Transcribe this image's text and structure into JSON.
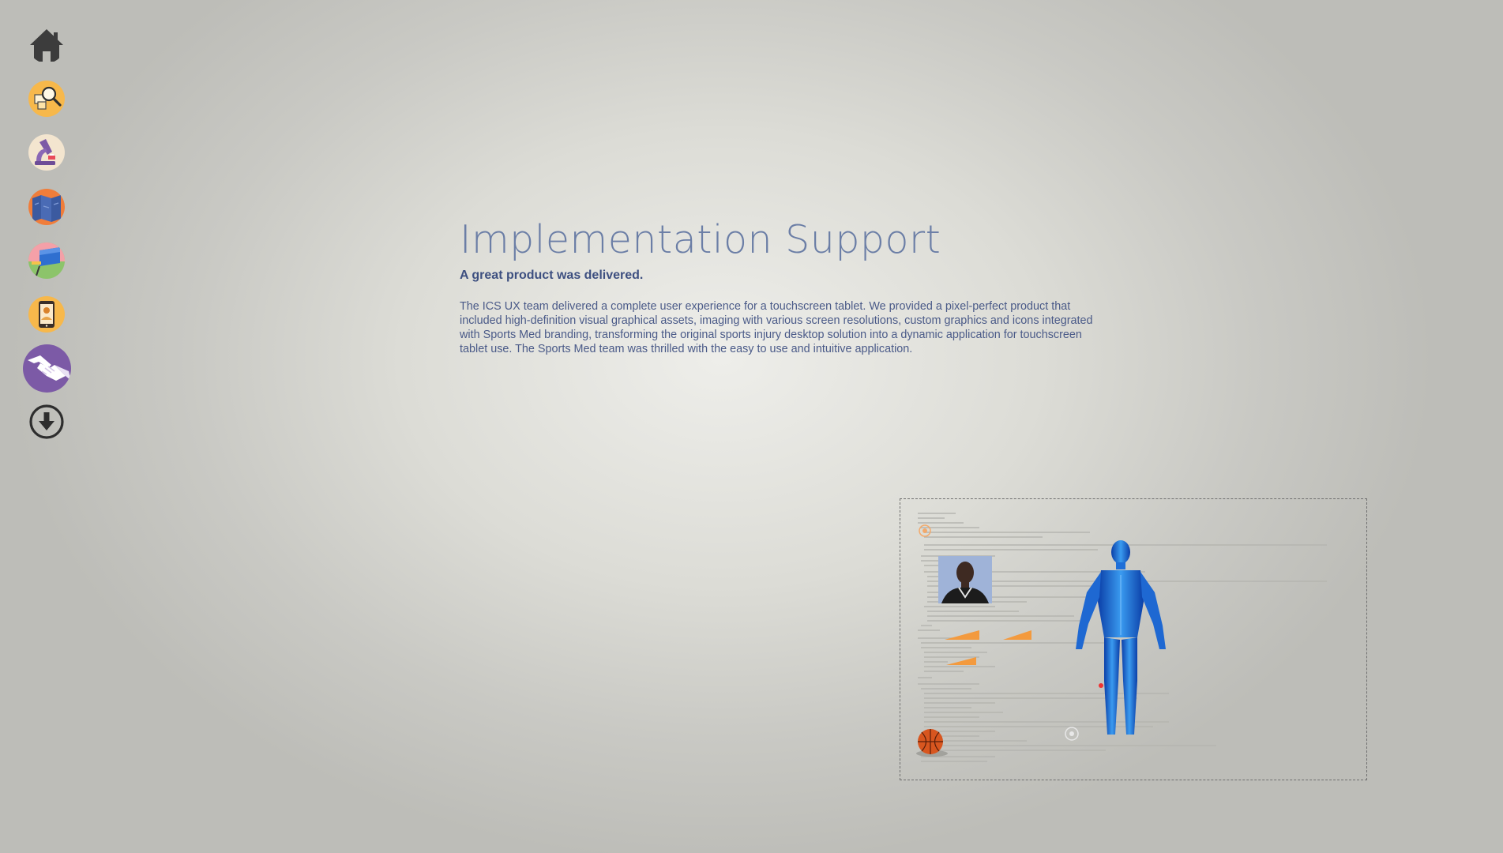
{
  "sidebar": {
    "items": [
      {
        "id": "home",
        "icon": "home-icon",
        "active": false
      },
      {
        "id": "research",
        "icon": "magnifier-analysis-icon",
        "active": false
      },
      {
        "id": "microscope",
        "icon": "microscope-icon",
        "active": false
      },
      {
        "id": "map",
        "icon": "folded-map-icon",
        "active": false
      },
      {
        "id": "design",
        "icon": "easel-design-icon",
        "active": false
      },
      {
        "id": "mobile",
        "icon": "tablet-user-icon",
        "active": false
      },
      {
        "id": "implementation",
        "icon": "handshake-icon",
        "active": true
      },
      {
        "id": "download",
        "icon": "download-circle-icon",
        "active": false
      }
    ],
    "colors": {
      "orange": "#f7b84b",
      "deep_orange": "#f07d3a",
      "purple": "#7c5aa6",
      "dark": "#3c3c3c"
    }
  },
  "main": {
    "title": "Implementation Support",
    "subtitle": "A great product was delivered.",
    "body": "The ICS UX team delivered a complete user experience for a touchscreen tablet. We provided a pixel-perfect product that included high-definition visual graphical assets, imaging with various screen resolutions, custom graphics and icons integrated with Sports Med branding, transforming the original sports injury desktop solution into a dynamic application for touchscreen tablet use. The Sports Med team was thrilled with the easy to use and intuitive application."
  },
  "showcase": {
    "elements": [
      "code-background",
      "athlete-photo",
      "anatomy-figure-illustration",
      "basketball-icon",
      "orange-ramp-graphics"
    ]
  }
}
